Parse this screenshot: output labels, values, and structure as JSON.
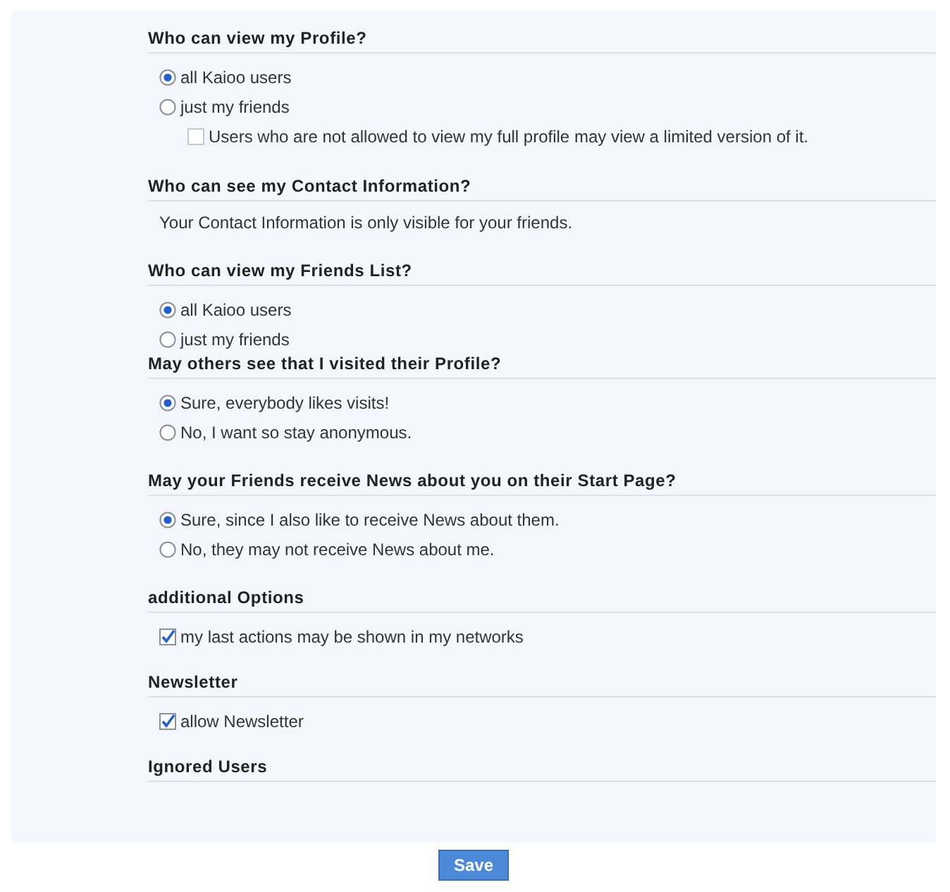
{
  "sections": [
    {
      "title": "Who can view my Profile?",
      "options": [
        {
          "kind": "radio",
          "label": "all Kaioo users",
          "selected": true
        },
        {
          "kind": "radio",
          "label": "just my friends",
          "selected": false,
          "children": [
            {
              "kind": "checkbox",
              "label": "Users who are not allowed to view my full profile may view a limited version of it.",
              "checked": false,
              "disabled": true
            }
          ]
        }
      ]
    },
    {
      "title": "Who can see my Contact Information?",
      "text": "Your Contact Information is only visible for your friends."
    },
    {
      "title": "Who can view my Friends List?",
      "options": [
        {
          "kind": "radio",
          "label": "all Kaioo users",
          "selected": true
        },
        {
          "kind": "radio",
          "label": "just my friends",
          "selected": false
        }
      ]
    },
    {
      "title": "May others see that I visited their Profile?",
      "options": [
        {
          "kind": "radio",
          "label": "Sure, everybody likes visits!",
          "selected": true
        },
        {
          "kind": "radio",
          "label": "No, I want so stay anonymous.",
          "selected": false
        }
      ]
    },
    {
      "title": "May your Friends receive News about you on their Start Page?",
      "options": [
        {
          "kind": "radio",
          "label": "Sure, since I also like to receive News about them.",
          "selected": true
        },
        {
          "kind": "radio",
          "label": "No, they may not receive News about me.",
          "selected": false
        }
      ]
    },
    {
      "title": "additional Options",
      "options": [
        {
          "kind": "checkbox",
          "label": "my last actions may be shown in my networks",
          "checked": true,
          "disabled": false
        }
      ]
    },
    {
      "title": "Newsletter",
      "options": [
        {
          "kind": "checkbox",
          "label": "allow Newsletter",
          "checked": true,
          "disabled": false
        }
      ]
    },
    {
      "title": "Ignored Users"
    }
  ],
  "save_button": "Save"
}
